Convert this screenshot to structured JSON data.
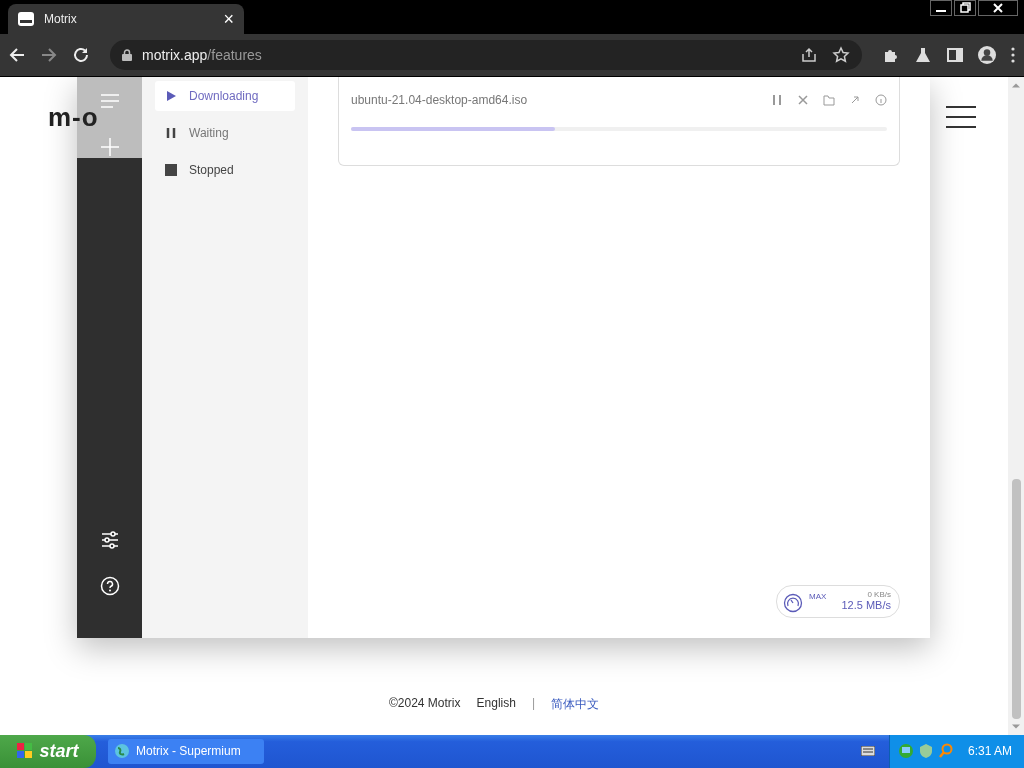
{
  "browser": {
    "tab": {
      "title": "Motrix",
      "close": "×"
    },
    "url": {
      "host": "motrix.app",
      "path": "/features"
    }
  },
  "site_header": {
    "logo": "m-o"
  },
  "app": {
    "task_filters": [
      {
        "label": "Downloading",
        "kind": "play",
        "selected": true
      },
      {
        "label": "Waiting",
        "kind": "pause",
        "selected": false
      },
      {
        "label": "Stopped",
        "kind": "stop",
        "selected": false
      }
    ],
    "task": {
      "name": "ubuntu-21.04-desktop-amd64.iso",
      "level": 0.38
    },
    "speed": {
      "max_label": "MAX",
      "upload": "0 KB/s",
      "download": "12.5 MB/s"
    }
  },
  "footer": [
    {
      "text": "©2024 Motrix",
      "kind": "text"
    },
    {
      "text": "English",
      "kind": "link"
    },
    {
      "text": "|",
      "kind": "separator"
    },
    {
      "text": "简体中文",
      "kind": "active-link"
    }
  ],
  "taskbar": {
    "start": "start",
    "window": "Motrix - Supermium",
    "clock": "6:31 AM"
  }
}
